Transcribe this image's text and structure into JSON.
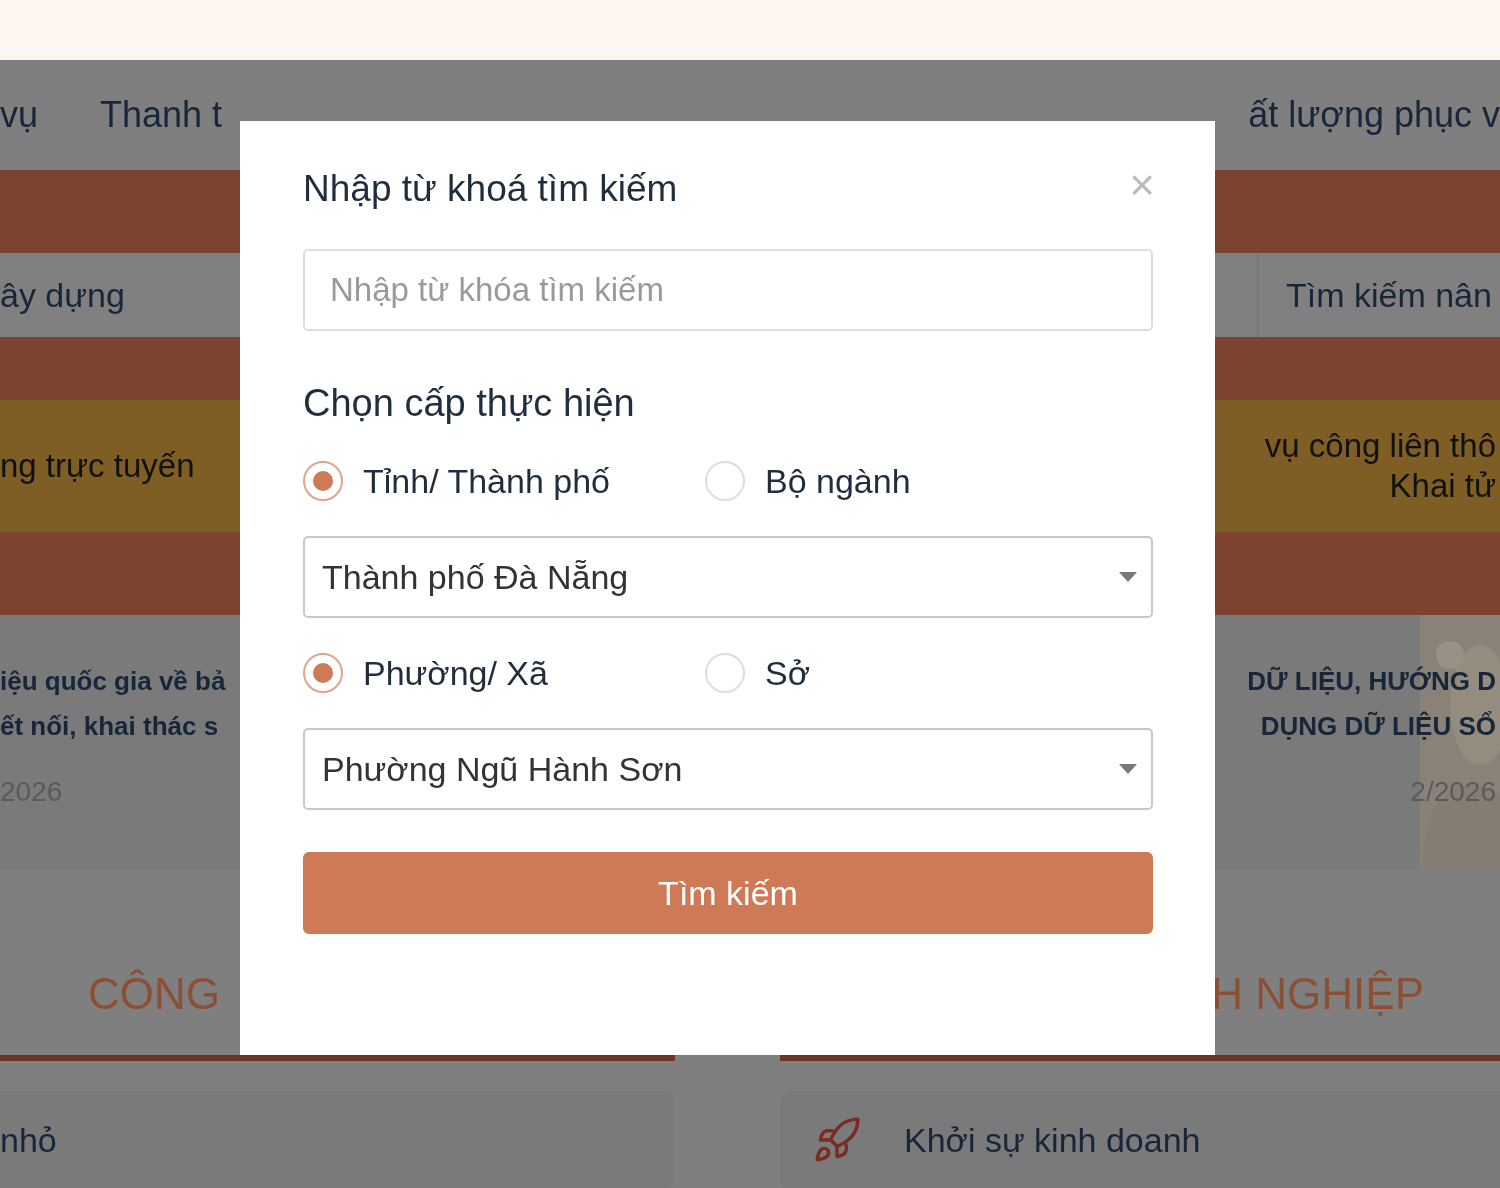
{
  "nav": {
    "items": [
      "vụ",
      "Thanh t",
      "ất lượng phục v"
    ]
  },
  "search_bar": {
    "left_text": "ây dựng",
    "advanced_search": "Tìm kiếm nân"
  },
  "banner": {
    "left_text": "ng trực tuyến",
    "right_lines": [
      "vụ công liên thô",
      "Khai tử"
    ]
  },
  "news": [
    {
      "title_lines": [
        "iệu quốc gia về bả",
        "ết nối, khai thác s"
      ],
      "date": "2026"
    },
    {
      "title_lines": [
        "DỮ LIỆU, HƯỚNG D",
        "DỤNG DỮ LIỆU SỔ"
      ],
      "date": "2/2026"
    }
  ],
  "sections": [
    {
      "heading": "CÔNG",
      "item": "nhỏ"
    },
    {
      "heading": "H NGHIỆP",
      "item": "Khởi sự kinh doanh"
    }
  ],
  "modal": {
    "title": "Nhập từ khoá tìm kiếm",
    "close": "×",
    "search_field": {
      "placeholder": "Nhập từ khóa tìm kiếm"
    },
    "level_heading": "Chọn cấp thực hiện",
    "level_groups": [
      {
        "options": [
          {
            "label": "Tỉnh/ Thành phố",
            "selected": true
          },
          {
            "label": "Bộ ngành",
            "selected": false
          }
        ],
        "select": {
          "value": "Thành phố Đà Nẵng"
        }
      },
      {
        "options": [
          {
            "label": "Phường/ Xã",
            "selected": true
          },
          {
            "label": "Sở",
            "selected": false
          }
        ],
        "select": {
          "value": "Phường Ngũ Hành Sơn"
        }
      }
    ],
    "submit": "Tìm kiếm"
  }
}
